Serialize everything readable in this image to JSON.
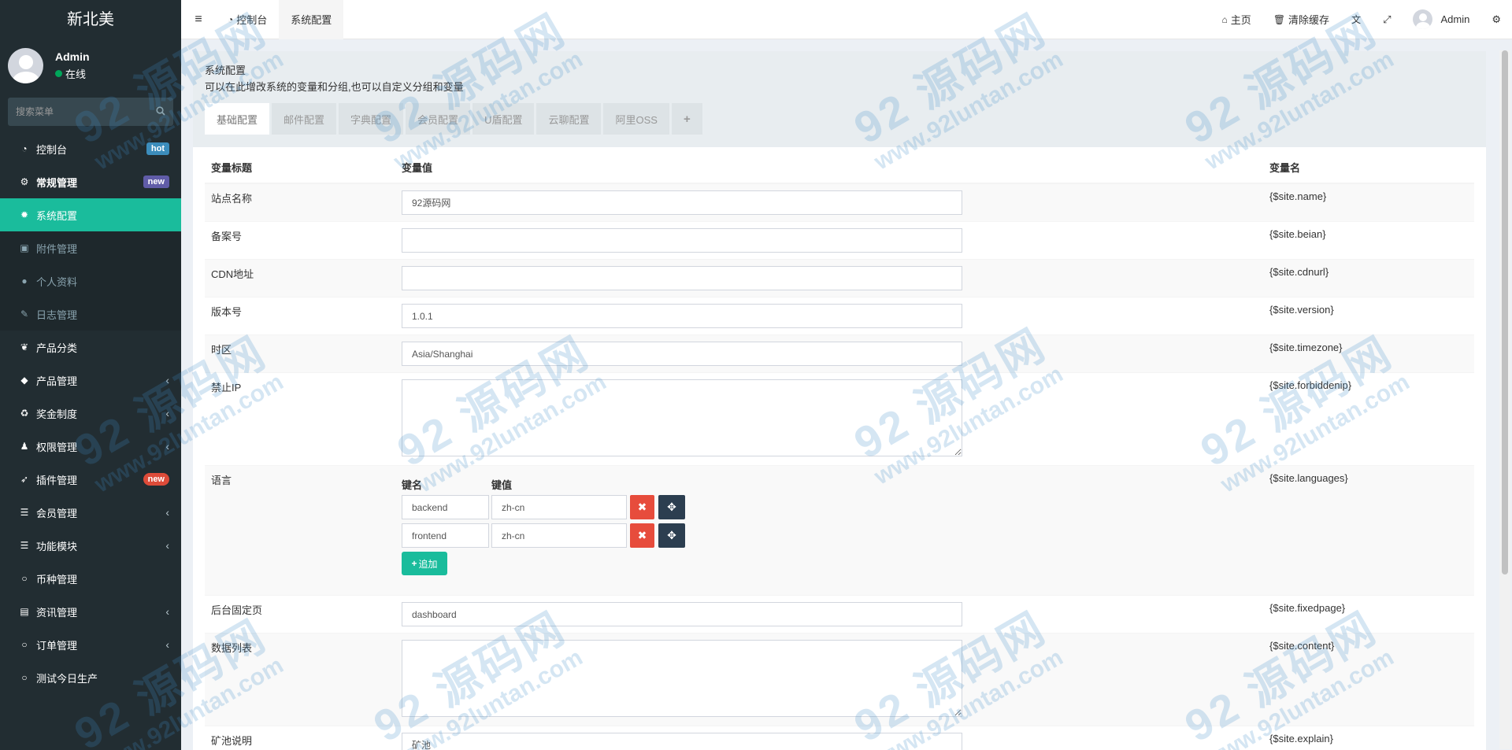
{
  "sidebar": {
    "logo": "新北美",
    "user": {
      "name": "Admin",
      "status": "在线"
    },
    "search_placeholder": "搜索菜单",
    "items": [
      {
        "label": "控制台",
        "icon": "dashboard-icon",
        "badge": "hot"
      },
      {
        "label": "常规管理",
        "icon": "cogs-icon",
        "badge": "new"
      },
      {
        "label": "系统配置",
        "icon": "cog-icon"
      },
      {
        "label": "附件管理",
        "icon": "file-image-icon"
      },
      {
        "label": "个人资料",
        "icon": "user-icon"
      },
      {
        "label": "日志管理",
        "icon": "log-icon"
      },
      {
        "label": "产品分类",
        "icon": "leaf-icon"
      },
      {
        "label": "产品管理",
        "icon": "diamond-icon"
      },
      {
        "label": "奖金制度",
        "icon": "recycle-icon"
      },
      {
        "label": "权限管理",
        "icon": "group-icon"
      },
      {
        "label": "插件管理",
        "icon": "rocket-icon",
        "badge": "new"
      },
      {
        "label": "会员管理",
        "icon": "list-icon"
      },
      {
        "label": "功能模块",
        "icon": "list-icon"
      },
      {
        "label": "币种管理",
        "icon": "circle-icon"
      },
      {
        "label": "资讯管理",
        "icon": "list-alt-icon"
      },
      {
        "label": "订单管理",
        "icon": "circle-icon"
      },
      {
        "label": "测试今日生产",
        "icon": "circle-icon"
      }
    ]
  },
  "navbar": {
    "tabs": [
      "控制台",
      "系统配置"
    ],
    "home": "主页",
    "clear_cache": "清除缓存",
    "user": "Admin"
  },
  "panel": {
    "title": "系统配置",
    "description": "可以在此增改系统的变量和分组,也可以自定义分组和变量",
    "tabs": [
      "基础配置",
      "邮件配置",
      "字典配置",
      "会员配置",
      "U盾配置",
      "云聊配置",
      "阿里OSS",
      "+"
    ]
  },
  "table": {
    "headers": [
      "变量标题",
      "变量值",
      "变量名"
    ],
    "rows": [
      {
        "title": "站点名称",
        "value": "92源码网",
        "var": "{$site.name}"
      },
      {
        "title": "备案号",
        "value": "",
        "var": "{$site.beian}"
      },
      {
        "title": "CDN地址",
        "value": "",
        "var": "{$site.cdnurl}"
      },
      {
        "title": "版本号",
        "value": "1.0.1",
        "var": "{$site.version}"
      },
      {
        "title": "时区",
        "value": "Asia/Shanghai",
        "var": "{$site.timezone}"
      },
      {
        "title": "禁止IP",
        "value": "",
        "var": "{$site.forbiddenip}"
      },
      {
        "title": "语言",
        "var": "{$site.languages}",
        "kv_headers": [
          "键名",
          "键值"
        ],
        "pairs": [
          {
            "key": "backend",
            "value": "zh-cn"
          },
          {
            "key": "frontend",
            "value": "zh-cn"
          }
        ],
        "add_label": "追加"
      },
      {
        "title": "后台固定页",
        "value": "dashboard",
        "var": "{$site.fixedpage}"
      },
      {
        "title": "数据列表",
        "value": "",
        "var": "{$site.content}"
      },
      {
        "title": "矿池说明",
        "value": "矿池",
        "var": "{$site.explain}"
      }
    ]
  },
  "watermark": {
    "line1": "92 源码网",
    "line2": "www.92luntan.com"
  },
  "colors": {
    "sidebar_bg": "#222d32",
    "accent": "#1abc9c",
    "danger": "#e74c3c",
    "dark": "#2c3e50"
  }
}
